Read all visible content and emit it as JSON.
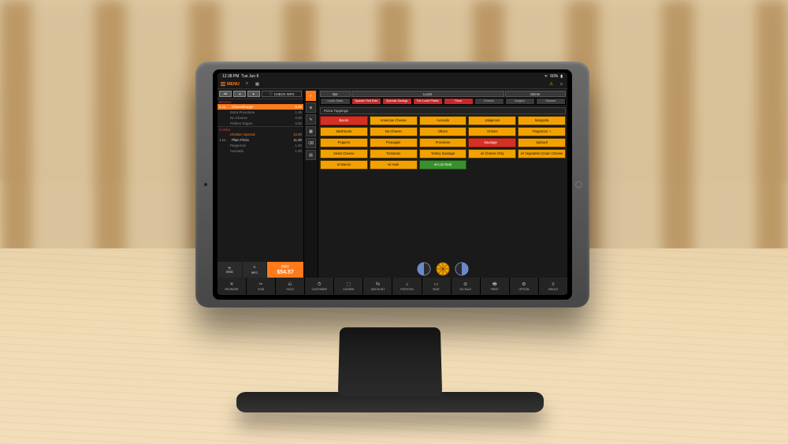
{
  "statusbar": {
    "time": "12:38 PM",
    "date": "Tue Jun 8",
    "wifi": "wifi",
    "battery": "60%"
  },
  "header": {
    "menu": "MENU"
  },
  "ticket": {
    "check_info": "CHECK INFO",
    "pay_label": "PAY",
    "pay_amount": "$54.57",
    "foot": [
      "SEND",
      "INFO"
    ],
    "rows": [
      {
        "t": "cat",
        "name": "Entrées",
        "price": ""
      },
      {
        "t": "item",
        "qty": "1  1x",
        "name": "Cheeseburger",
        "price": "6.00",
        "sel": true
      },
      {
        "t": "modsub",
        "name": "Extra Provolone",
        "price": "1.00"
      },
      {
        "t": "modsub",
        "name": "No Cheese",
        "price": "0.00"
      },
      {
        "t": "modsub",
        "name": "Pickles Topper",
        "price": "0.00"
      },
      {
        "t": "cat",
        "name": "Combo",
        "price": ""
      },
      {
        "t": "mod",
        "qty": "1  1x",
        "name": "Chicken Special",
        "price": "10.00"
      },
      {
        "t": "item",
        "qty": "1  1x",
        "name": "Plain Pizza",
        "price": "11.00"
      },
      {
        "t": "modsub",
        "name": "Pepperoni",
        "price": "1.00"
      },
      {
        "t": "modsub",
        "name": "Avocado",
        "price": "1.00"
      }
    ]
  },
  "rail": [
    {
      "icon": "✓",
      "done": true,
      "name": "done"
    },
    {
      "icon": "⊕",
      "name": "add"
    },
    {
      "icon": "✎",
      "name": "edit"
    },
    {
      "icon": "▦",
      "name": "grid"
    },
    {
      "icon": "⌫",
      "name": "delete"
    },
    {
      "icon": "▤",
      "name": "list"
    }
  ],
  "cats": {
    "cols": [
      {
        "hdr": "Bar",
        "subs": [
          {
            "l": "Lunch Sides",
            "c": "c-dim"
          }
        ]
      },
      {
        "hdr": "Lunch",
        "subs": [
          {
            "l": "Spanish Red Hots",
            "c": "c-red"
          },
          {
            "l": "Specials Savings",
            "c": "c-red"
          },
          {
            "l": "The Lunch Platter",
            "c": "c-red"
          },
          {
            "l": "Pizza",
            "c": "c-red"
          },
          {
            "l": "Entrées",
            "c": "c-dim"
          }
        ]
      },
      {
        "hdr": "Dinner",
        "subs": [
          {
            "l": "Burgers",
            "c": "c-dim"
          },
          {
            "l": "Dessert",
            "c": "c-dim"
          }
        ]
      }
    ]
  },
  "section_title": "Pizza Toppings",
  "toppings": [
    {
      "l": "Bacon",
      "c": "t-r"
    },
    {
      "l": "American Cheese",
      "c": "t-o"
    },
    {
      "l": "Avocado",
      "c": "t-o"
    },
    {
      "l": "Jalapenos",
      "c": "t-o"
    },
    {
      "l": "Margarita",
      "c": "t-o"
    },
    {
      "l": "Mushroom",
      "c": "t-o"
    },
    {
      "l": "No Cheese",
      "c": "t-o"
    },
    {
      "l": "Olives",
      "c": "t-o"
    },
    {
      "l": "Onions",
      "c": "t-o"
    },
    {
      "l": "Pepperoni +",
      "c": "t-oplus"
    },
    {
      "l": "Peppers",
      "c": "t-o"
    },
    {
      "l": "Pineapple",
      "c": "t-o"
    },
    {
      "l": "Provolone",
      "c": "t-o"
    },
    {
      "l": "Sausage +",
      "c": "t-r"
    },
    {
      "l": "Spinach",
      "c": "t-o"
    },
    {
      "l": "Swiss Cheese",
      "c": "t-o"
    },
    {
      "l": "Tomatoes",
      "c": "t-o"
    },
    {
      "l": "Turkey Sausage",
      "c": "t-o"
    },
    {
      "l": "w/ Cheese Only",
      "c": "t-o"
    },
    {
      "l": "w/ Vegetable Cream Cheese",
      "c": "t-o"
    },
    {
      "l": "w/ Bacon",
      "c": "t-o"
    },
    {
      "l": "w/ Ham",
      "c": "t-o"
    },
    {
      "l": "w/ Lox Deal",
      "c": "t-g"
    }
  ],
  "bottom": [
    {
      "ic": "✕",
      "l": "REORDER"
    },
    {
      "ic": "✂",
      "l": "VOID"
    },
    {
      "ic": "⎌",
      "l": "HOLD"
    },
    {
      "ic": "⏱",
      "l": "CUSTOMER"
    },
    {
      "ic": "⬚",
      "l": "COURSE"
    },
    {
      "ic": "%",
      "l": "DISCOUNT"
    },
    {
      "ic": "⌂",
      "l": "POSITION"
    },
    {
      "ic": "▭",
      "l": "SEAT"
    },
    {
      "ic": "⊘",
      "l": "NO SALE"
    },
    {
      "ic": "🖶",
      "l": "PRINT"
    },
    {
      "ic": "⚙",
      "l": "OPTION"
    },
    {
      "ic": "≡",
      "l": "SINGLE"
    }
  ]
}
